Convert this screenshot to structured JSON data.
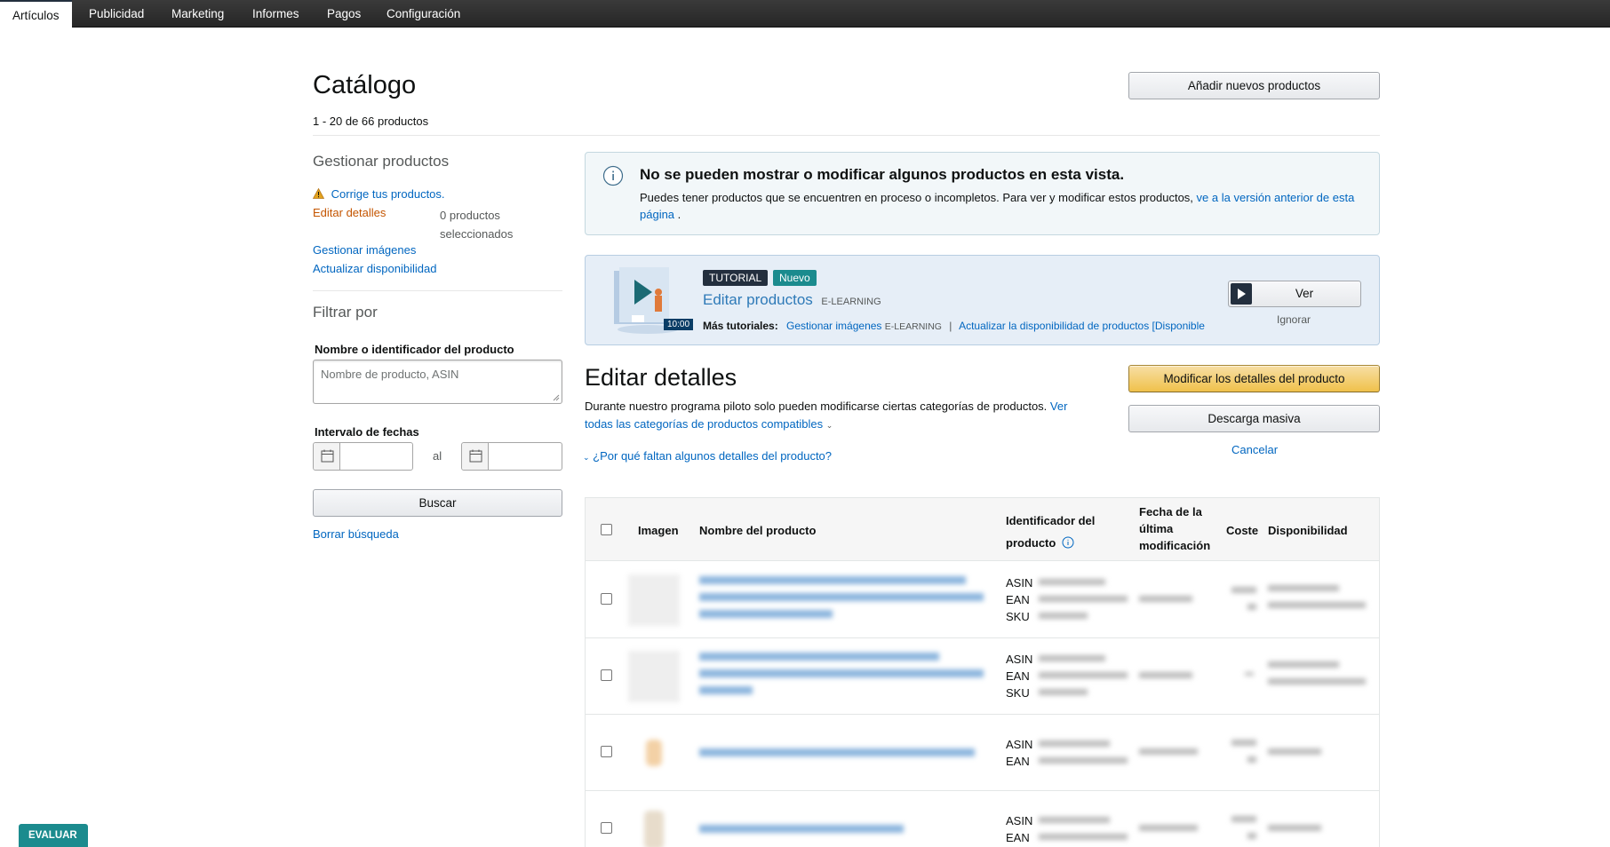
{
  "nav": {
    "tabs": [
      "Artículos",
      "Publicidad",
      "Marketing",
      "Informes",
      "Pagos",
      "Configuración"
    ]
  },
  "header": {
    "title": "Catálogo",
    "count_range": "1 - 20",
    "count_rest": " de 66 productos",
    "add_button": "Añadir nuevos productos"
  },
  "sidebar": {
    "manage_heading": "Gestionar productos",
    "fix_link": "Corrige tus productos.",
    "edit_details": "Editar detalles",
    "selected_count": "0 productos seleccionados",
    "manage_images": "Gestionar imágenes",
    "update_availability": "Actualizar disponibilidad",
    "filter_heading": "Filtrar por",
    "name_label": "Nombre o identificador del producto",
    "name_placeholder": "Nombre de producto, ASIN",
    "date_label": "Intervalo de fechas",
    "date_separator": "al",
    "search_button": "Buscar",
    "clear_search": "Borrar búsqueda"
  },
  "alert": {
    "title": "No se pueden mostrar o modificar algunos productos en esta vista.",
    "body": "Puedes tener productos que se encuentren en proceso o incompletos. Para ver y modificar estos productos,",
    "link": "ve a la versión anterior de esta página",
    "end": " ."
  },
  "tutorial": {
    "badge_tutorial": "TUTORIAL",
    "badge_new": "Nuevo",
    "title": "Editar productos",
    "tag": "E-LEARNING",
    "duration": "10:00",
    "more_label": "Más tutoriales:",
    "more_link1": "Gestionar imágenes",
    "more_tag1": "E-LEARNING",
    "separator": "|",
    "more_link2": "Actualizar la disponibilidad de productos [Disponible",
    "view_button": "Ver",
    "ignore": "Ignorar"
  },
  "edit": {
    "title": "Editar detalles",
    "desc": "Durante nuestro programa piloto solo pueden modificarse ciertas categorías de productos.",
    "desc_link": "Ver todas las categorías de productos compatibles",
    "why_link": "¿Por qué faltan algunos detalles del producto?",
    "modify_button": "Modificar los detalles del producto",
    "bulk_button": "Descarga masiva",
    "cancel": "Cancelar"
  },
  "table": {
    "headers": {
      "image": "Imagen",
      "name": "Nombre del producto",
      "identifier": "Identificador del producto",
      "date": "Fecha de la última modificación",
      "cost": "Coste",
      "availability": "Disponibilidad"
    },
    "id_labels": [
      "ASIN",
      "EAN",
      "SKU"
    ]
  },
  "evaluar": "EVALUAR",
  "colors": {
    "nav_bg": "#262626",
    "link": "#0066c0",
    "primary_button": "#f0c14b",
    "alert_bg": "#f2f7f9",
    "tutorial_bg": "#e6eef7",
    "badge_tutorial": "#232f3e",
    "badge_new": "#1b8b8e",
    "warning": "#e3a31d",
    "edit_details_active": "#c45500"
  }
}
